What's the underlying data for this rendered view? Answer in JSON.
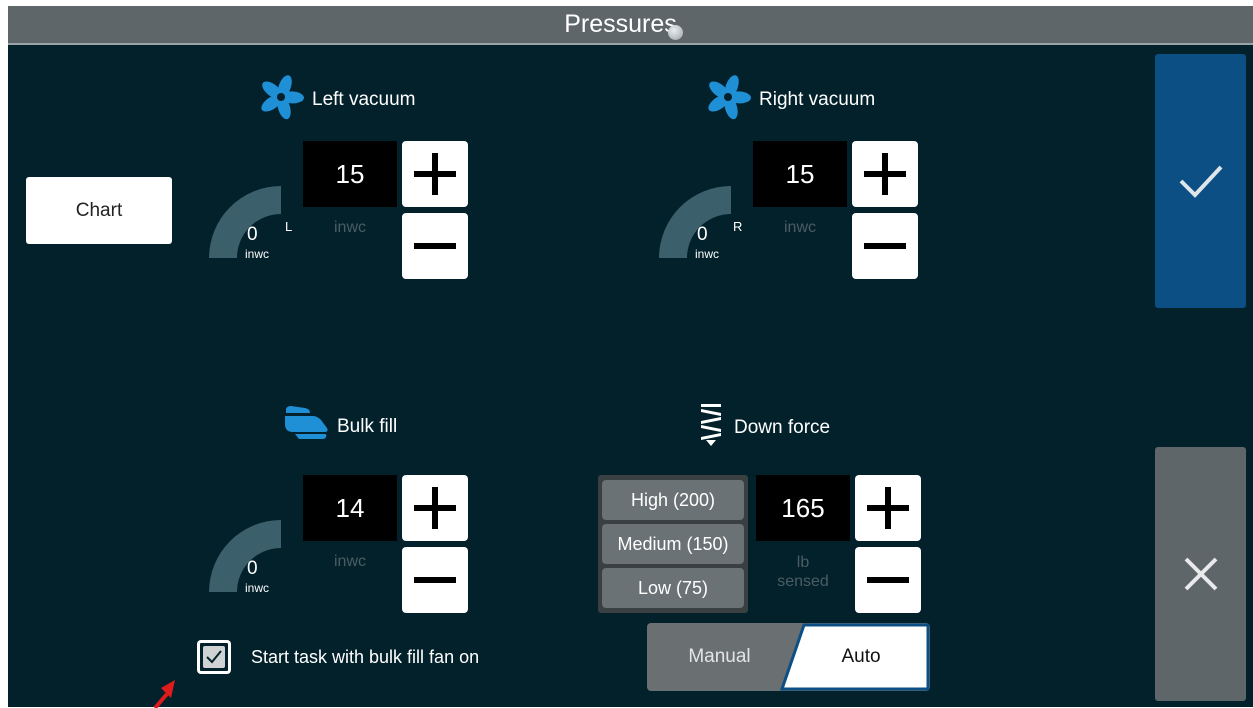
{
  "header": {
    "title": "Pressures"
  },
  "chart_button": {
    "label": "Chart"
  },
  "left_vacuum": {
    "title": "Left vacuum",
    "setpoint": "15",
    "setpoint_unit": "inwc",
    "gauge_value": "0",
    "gauge_unit": "inwc",
    "gauge_side": "L"
  },
  "right_vacuum": {
    "title": "Right vacuum",
    "setpoint": "15",
    "setpoint_unit": "inwc",
    "gauge_value": "0",
    "gauge_unit": "inwc",
    "gauge_side": "R"
  },
  "bulk_fill": {
    "title": "Bulk fill",
    "setpoint": "14",
    "setpoint_unit": "inwc",
    "gauge_value": "0",
    "gauge_unit": "inwc"
  },
  "down_force": {
    "title": "Down force",
    "setpoint": "165",
    "setpoint_unit_line1": "lb",
    "setpoint_unit_line2": "sensed",
    "levels": [
      "High (200)",
      "Medium (150)",
      "Low (75)"
    ]
  },
  "mode_toggle": {
    "manual_label": "Manual",
    "auto_label": "Auto",
    "selected": "Auto"
  },
  "bulk_fan_option": {
    "label": "Start task with bulk fill fan on",
    "checked": true
  },
  "icons": {
    "fan": "fan-icon",
    "bulk_fill": "bulk-fill-icon",
    "down_force": "spring-icon",
    "confirm": "check-icon",
    "cancel": "close-icon"
  },
  "colors": {
    "background": "#03212b",
    "title_bar": "#5e6669",
    "accent_blue": "#1f8fd6",
    "confirm_button": "#0b4f84",
    "cancel_button": "#5f6669",
    "gauge": "#3b5f6b",
    "pointer": "#e01b1b"
  }
}
